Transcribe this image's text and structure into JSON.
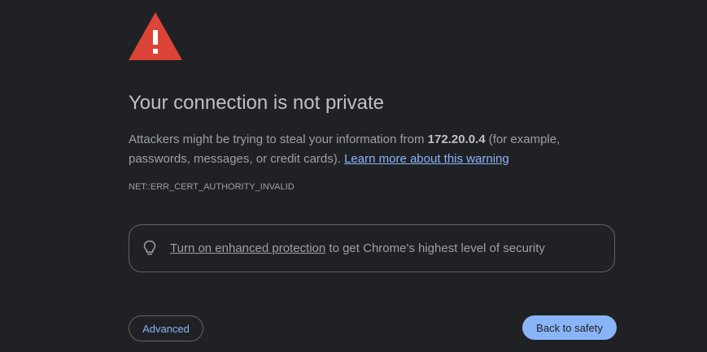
{
  "page": {
    "title": "Your connection is not private",
    "message": {
      "before_host": "Attackers might be trying to steal your information from ",
      "host": "172.20.0.4",
      "after_host": " (for example, passwords, messages, or credit cards). ",
      "learn_more_label": "Learn more about this warning"
    },
    "error_code": "NET::ERR_CERT_AUTHORITY_INVALID",
    "enhanced_protection": {
      "icon": "lightbulb-icon",
      "link_label": "Turn on enhanced protection",
      "suffix": " to get Chrome's highest level of security"
    },
    "buttons": {
      "advanced_label": "Advanced",
      "back_label": "Back to safety"
    }
  },
  "icons": {
    "warning": "warning-triangle-icon"
  },
  "colors": {
    "background": "#202124",
    "warning_red": "#db4437",
    "accent": "#8ab4f8",
    "text": "#9aa0a6",
    "title": "#bdc1c6",
    "border": "#5f6368"
  }
}
